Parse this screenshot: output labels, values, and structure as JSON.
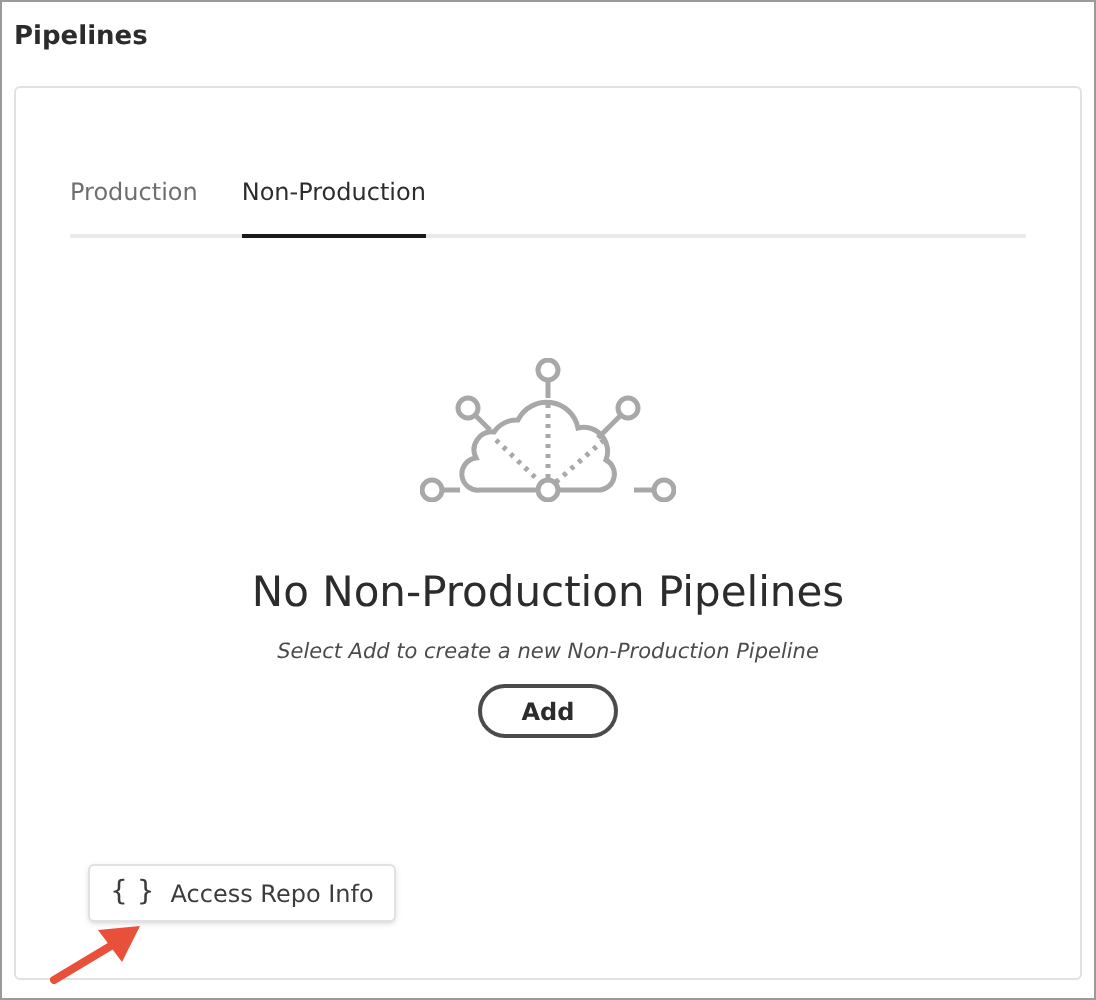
{
  "title": "Pipelines",
  "tabs": [
    {
      "label": "Production",
      "selected": false
    },
    {
      "label": "Non-Production",
      "selected": true
    }
  ],
  "empty_state": {
    "heading": "No Non-Production Pipelines",
    "message": "Select Add to create a new Non-Production Pipeline",
    "button": "Add"
  },
  "repo_button": {
    "icon": "{ }",
    "label": "Access Repo Info"
  }
}
